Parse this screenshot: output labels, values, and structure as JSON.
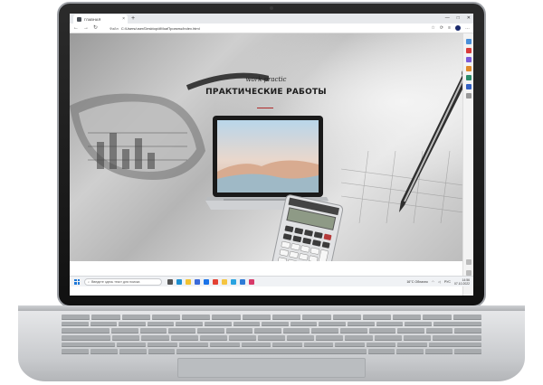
{
  "browser": {
    "tab_title": "ГЛАВНАЯ",
    "tab_close": "×",
    "new_tab": "+",
    "window_controls": [
      "—",
      "□",
      "✕"
    ],
    "nav": {
      "back": "←",
      "forward": "→",
      "reload": "↻"
    },
    "url_prefix": "Файл",
    "url": "C:/Users/user/Desktop/#МоиПроекты/index.html",
    "address_icons": [
      "☆",
      "⟳",
      "≡",
      "…"
    ]
  },
  "page": {
    "subtitle": "work practic",
    "title": "ПРАКТИЧЕСКИЕ РАБОТЫ",
    "accent_color": "#b02a2a",
    "background_theme": "grayscale"
  },
  "taskbar": {
    "search_placeholder": "Введите здесь текст для поиска",
    "weather": "16°C Облачно",
    "language": "РУС",
    "time": "14:56",
    "date": "07.10.2022",
    "apps": [
      "task-view",
      "edge",
      "explorer",
      "store",
      "mail",
      "chrome",
      "yandex",
      "telegram",
      "vscode",
      "opera"
    ]
  },
  "colors": {
    "start_blue": "#1e78d7",
    "profile": "#1a2a6c",
    "bezel": "#111111"
  }
}
